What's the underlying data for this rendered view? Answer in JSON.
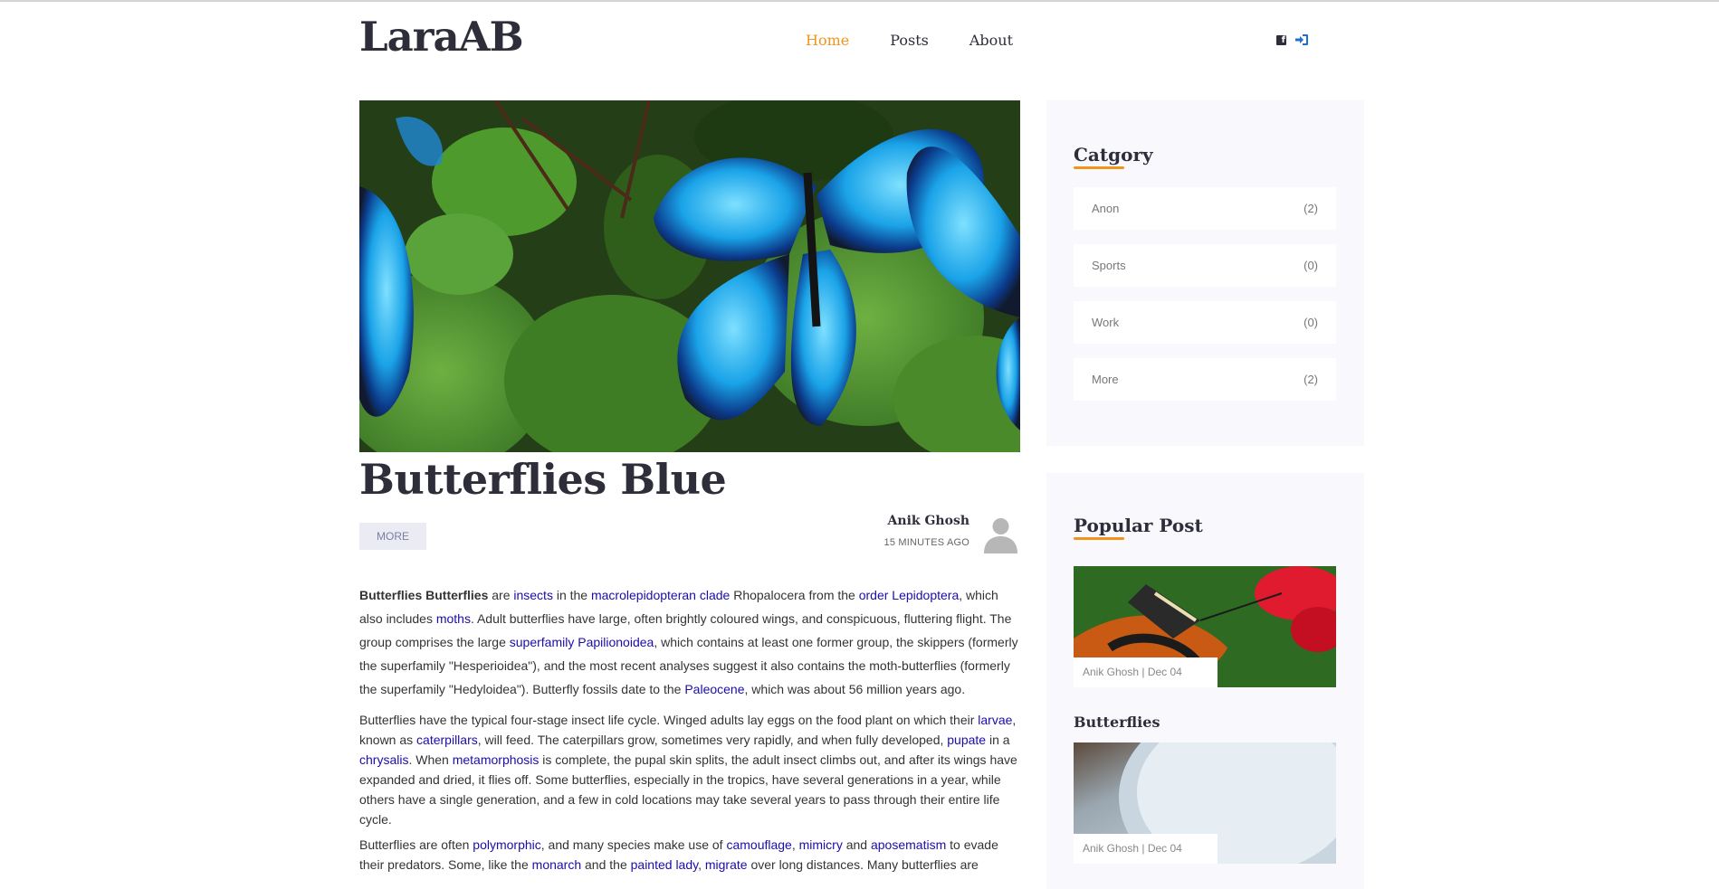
{
  "site": {
    "logo": "LaraAB"
  },
  "nav": {
    "items": [
      "Home",
      "Posts",
      "About"
    ]
  },
  "post": {
    "title": "Butterflies Blue",
    "tag": "MORE",
    "author": "Anik Ghosh",
    "time": "15 MINUTES AGO",
    "paragraph1": [
      {
        "t": "Butterflies Butterflies",
        "b": true
      },
      {
        "t": " are "
      },
      {
        "t": "insects",
        "l": true
      },
      {
        "t": " in the "
      },
      {
        "t": "macrolepidopteran clade",
        "l": true
      },
      {
        "t": " Rhopalocera from the "
      },
      {
        "t": "order Lepidoptera",
        "l": true
      },
      {
        "t": ", which also includes "
      },
      {
        "t": "moths",
        "l": true
      },
      {
        "t": ". Adult butterflies have large, often brightly coloured wings, and conspicuous, fluttering flight. The group comprises the large "
      },
      {
        "t": "superfamily Papilionoidea",
        "l": true
      },
      {
        "t": ", which contains at least one former group, the skippers (formerly the superfamily \"Hesperioidea\"), and the most recent analyses suggest it also contains the moth-butterflies (formerly the superfamily \"Hedyloidea\"). Butterfly fossils date to the "
      },
      {
        "t": "Paleocene",
        "l": true
      },
      {
        "t": ", which was about 56 million years ago."
      }
    ],
    "paragraph2": [
      {
        "t": "Butterflies have the typical four-stage insect life cycle. Winged adults lay eggs on the food plant on which their "
      },
      {
        "t": "larvae",
        "l": true
      },
      {
        "t": ", known as "
      },
      {
        "t": "caterpillars",
        "l": true
      },
      {
        "t": ", will feed. The caterpillars grow, sometimes very rapidly, and when fully developed, "
      },
      {
        "t": "pupate",
        "l": true
      },
      {
        "t": " in a "
      },
      {
        "t": "chrysalis",
        "l": true
      },
      {
        "t": ". When "
      },
      {
        "t": "metamorphosis",
        "l": true
      },
      {
        "t": " is complete, the pupal skin splits, the adult insect climbs out, and after its wings have expanded and dried, it flies off. Some butterflies, especially in the tropics, have several generations in a year, while others have a single generation, and a few in cold locations may take several years to pass through their entire life cycle."
      }
    ],
    "paragraph3": [
      {
        "t": "Butterflies are often "
      },
      {
        "t": "polymorphic",
        "l": true
      },
      {
        "t": ", and many species make use of "
      },
      {
        "t": "camouflage",
        "l": true
      },
      {
        "t": ", "
      },
      {
        "t": "mimicry",
        "l": true
      },
      {
        "t": " and "
      },
      {
        "t": "aposematism",
        "l": true
      },
      {
        "t": " to evade their predators. Some, like the "
      },
      {
        "t": "monarch",
        "l": true
      },
      {
        "t": " and the "
      },
      {
        "t": "painted lady",
        "l": true
      },
      {
        "t": ", "
      },
      {
        "t": "migrate",
        "l": true
      },
      {
        "t": " over long distances. Many butterflies are"
      }
    ]
  },
  "sidebar": {
    "category_title": "Catgory",
    "categories": [
      {
        "name": "Anon",
        "count": "(2)"
      },
      {
        "name": "Sports",
        "count": "(0)"
      },
      {
        "name": "Work",
        "count": "(0)"
      },
      {
        "name": "More",
        "count": "(2)"
      }
    ],
    "popular_title": "Popular Post",
    "popular": [
      {
        "meta": "Anik Ghosh  |   Dec 04",
        "title": "Butterflies"
      },
      {
        "meta": "Anik Ghosh  |   Dec 04",
        "title": ""
      }
    ]
  },
  "colors": {
    "accent": "#f0941c",
    "link": "#1a0dab",
    "dark": "#2e2e3a",
    "sidebar_bg": "#f8f8fd"
  },
  "icons": {
    "facebook": "facebook-icon",
    "login": "sign-in-icon"
  }
}
